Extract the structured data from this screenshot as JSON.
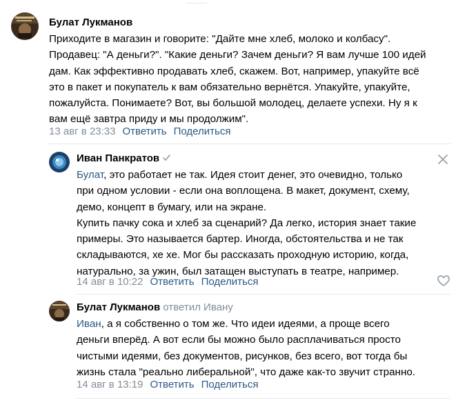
{
  "actions": {
    "reply": "Ответить",
    "share": "Поделиться"
  },
  "comments": [
    {
      "author": "Булат Лукманов",
      "lines": [
        "Приходите в магазин и говорите: \"Дайте мне хлеб, молоко и колбасу\".",
        "Продавец: \"А деньги?\". \"Какие деньги? Зачем деньги? Я вам лучше 100 идей",
        "дам. Как эффективно продавать хлеб, скажем. Вот, например, упакуйте всё",
        "это в пакет и покупатель к вам обязательно вернётся. Упакуйте, упакуйте,",
        "пожалуйста. Понимаете? Вот, вы большой молодец, делаете успехи. Ну я к",
        "вам ещё завтра приду и мы продолжим\"."
      ],
      "date": "13 авг в 23:33"
    },
    {
      "author": "Иван Панкратов",
      "mention": "Булат",
      "lines": [
        ", это работает не так. Идея стоит денег, это очевидно, только",
        "при одном условии - если она воплощена. В макет, документ, схему,",
        "демо, концепт в бумагу, или на экране.",
        "Купить пачку сока и хлеб за сценарий? Да легко, история знает такие",
        "примеры. Это называется бартер. Иногда, обстоятельства и не так",
        "складываются, хе хе. Мог бы рассказать проходную историю, когда,",
        "натурально, за ужин, был затащен выступать в театре, например."
      ],
      "date": "14 авг в 10:22"
    },
    {
      "author": "Булат Лукманов",
      "replied_to": "ответил Ивану",
      "mention": "Иван",
      "lines": [
        ", а я собственно о том же. Что идеи идеями, а проще всего",
        "деньги вперёд. А вот если бы можно было расплачиваться просто",
        "чистыми идеями, без документов, рисунков, без всего, вот тогда бы",
        "жизнь стала \"реально либеральной\", что даже как-то звучит странно."
      ],
      "date": "14 авг в 13:19"
    }
  ]
}
